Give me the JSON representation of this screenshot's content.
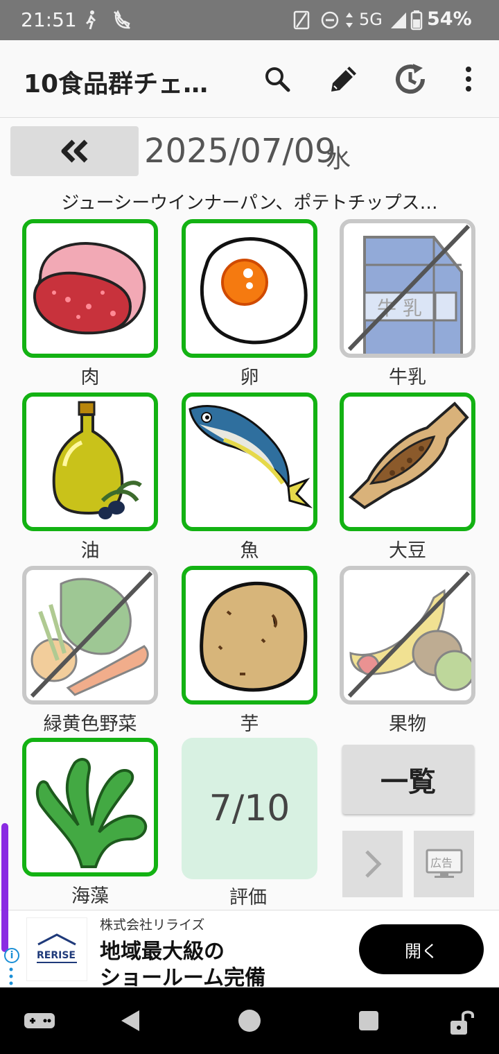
{
  "status_bar": {
    "time": "21:51",
    "network": "5G",
    "battery": "54%"
  },
  "app_bar": {
    "title": "10食品群チェ…"
  },
  "date_row": {
    "date": "2025/07/09",
    "weekday": "水"
  },
  "meal_text": "ジューシーウインナーパン、ポテトチップス…",
  "food_groups": [
    {
      "label": "肉",
      "checked": true
    },
    {
      "label": "卵",
      "checked": true
    },
    {
      "label": "牛乳",
      "checked": false,
      "image_text": "牛 乳"
    },
    {
      "label": "油",
      "checked": true
    },
    {
      "label": "魚",
      "checked": true
    },
    {
      "label": "大豆",
      "checked": true
    },
    {
      "label": "緑黄色野菜",
      "checked": false
    },
    {
      "label": "芋",
      "checked": true
    },
    {
      "label": "果物",
      "checked": false
    },
    {
      "label": "海藻",
      "checked": true
    }
  ],
  "score": {
    "value": "7/10",
    "label": "評価"
  },
  "buttons": {
    "list_label": "一覧",
    "ad_icon_text": "広告"
  },
  "ad": {
    "logo_text": "RERISE",
    "company": "株式会社リライズ",
    "headline_1": "地域最大級の",
    "headline_2": "ショールーム完備",
    "cta": "開く"
  },
  "colors": {
    "checked_border": "#13b213",
    "unchecked_border": "#c8c8c8",
    "score_bg": "#d8f1e2",
    "scrollbar": "#8a2be2"
  }
}
